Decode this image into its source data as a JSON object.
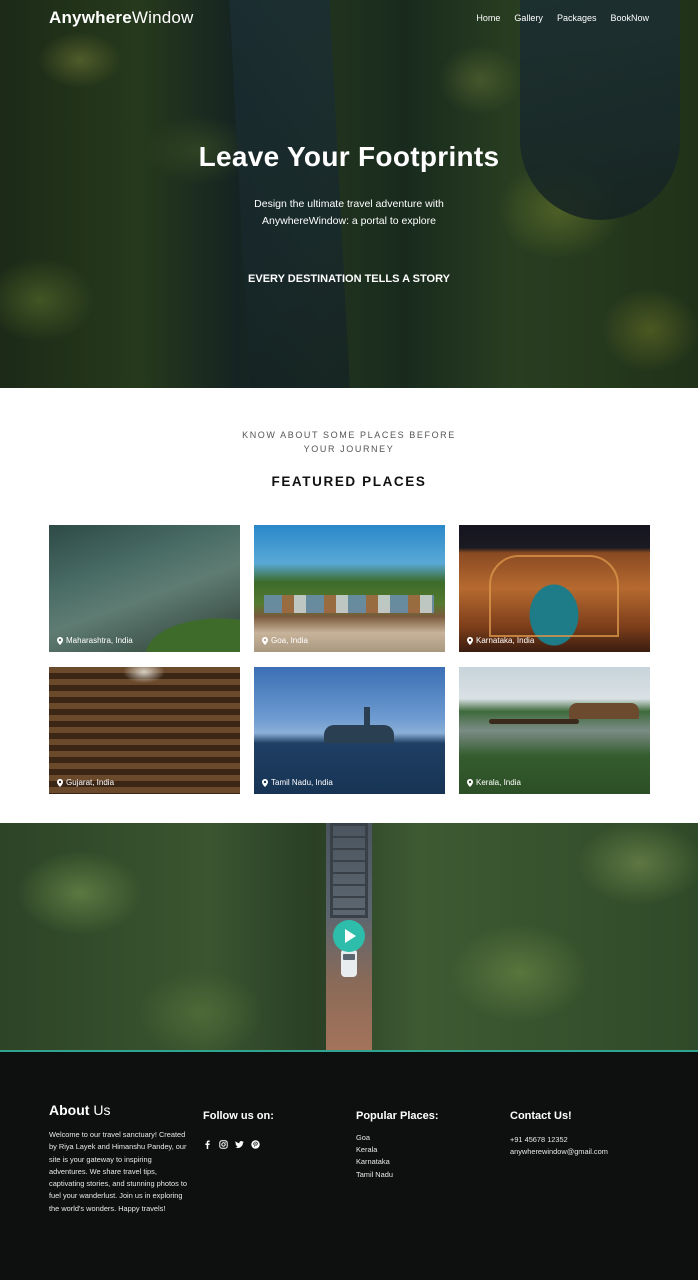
{
  "brand": {
    "bold": "Anywhere",
    "light": "Window"
  },
  "nav": {
    "items": [
      "Home",
      "Gallery",
      "Packages",
      "BookNow"
    ]
  },
  "hero": {
    "title": "Leave Your Footprints",
    "subtitle_line1": "Design the ultimate travel adventure with",
    "subtitle_line2": "AnywhereWindow: a portal to explore",
    "tagline": "EVERY DESTINATION TELLS A STORY"
  },
  "featured": {
    "kicker_line1": "KNOW ABOUT SOME PLACES BEFORE",
    "kicker_line2": "YOUR JOURNEY",
    "title": "FEATURED PLACES",
    "places": [
      {
        "label": "Maharashtra, India"
      },
      {
        "label": "Goa, India"
      },
      {
        "label": "Karnataka, India"
      },
      {
        "label": "Gujarat, India"
      },
      {
        "label": "Tamil Nadu, India"
      },
      {
        "label": "Kerala, India"
      }
    ]
  },
  "video": {
    "play_icon": "play-icon",
    "accent": "#2dbdaa"
  },
  "footer": {
    "about_bold": "About",
    "about_light": "Us",
    "about_text": "Welcome to our travel sanctuary! Created by Riya Layek and Himanshu Pandey, our site is your gateway to inspiring adventures. We share travel tips, captivating stories, and stunning photos to fuel your wanderlust. Join us in exploring the world's wonders. Happy travels!",
    "follow_title": "Follow us on:",
    "social_icons": [
      "facebook-icon",
      "instagram-icon",
      "twitter-icon",
      "pinterest-icon"
    ],
    "popular_title": "Popular Places:",
    "popular": [
      "Goa",
      "Kerala",
      "Karnataka",
      "Tamil Nadu"
    ],
    "contact_title": "Contact Us!",
    "phone": "+91 45678 12352",
    "email": "anywherewindow@gmail.com"
  }
}
